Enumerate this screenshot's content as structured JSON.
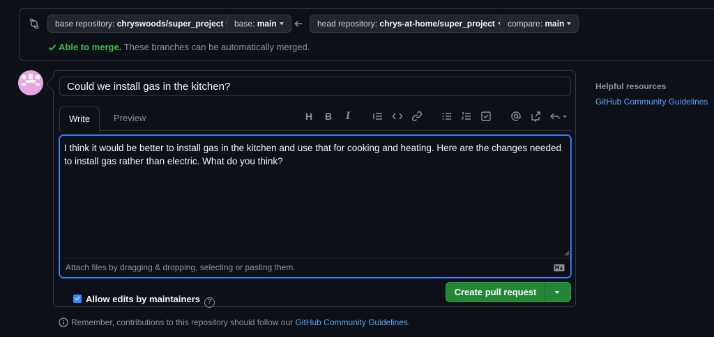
{
  "compare": {
    "base_repo": {
      "label": "base repository:",
      "value": "chryswoods/super_project"
    },
    "base": {
      "label": "base:",
      "value": "main"
    },
    "head_repo": {
      "label": "head repository:",
      "value": "chrys-at-home/super_project"
    },
    "compare": {
      "label": "compare:",
      "value": "main"
    },
    "merge_ok": "Able to merge.",
    "merge_msg": "These branches can be automatically merged."
  },
  "pr": {
    "title": "Could we install gas in the kitchen?",
    "tabs": {
      "write": "Write",
      "preview": "Preview"
    },
    "toolbar_icons": [
      "heading-icon",
      "bold-icon",
      "italic-icon",
      "quote-icon",
      "code-icon",
      "link-icon",
      "unordered-list-icon",
      "ordered-list-icon",
      "task-list-icon",
      "mention-icon",
      "reference-icon",
      "reply-icon"
    ],
    "toolbar": {
      "heading": "H",
      "bold": "B",
      "italic": "I"
    },
    "body": "I think it would be better to install gas in the kitchen and use that for cooking and heating. Here are the changes needed to install gas rather than electric. What do you think?",
    "attach_hint": "Attach files by dragging & dropping, selecting or pasting them.",
    "allow_edits": "Allow edits by maintainers",
    "create_button": "Create pull request"
  },
  "footer": {
    "prefix": "Remember, contributions to this repository should follow our",
    "link": "GitHub Community Guidelines",
    "suffix": "."
  },
  "sidebar": {
    "heading": "Helpful resources",
    "link": "GitHub Community Guidelines"
  },
  "colors": {
    "background": "#0d1117",
    "accent": "#58a6ff",
    "success": "#238636",
    "merge_ok": "#3fb950"
  }
}
